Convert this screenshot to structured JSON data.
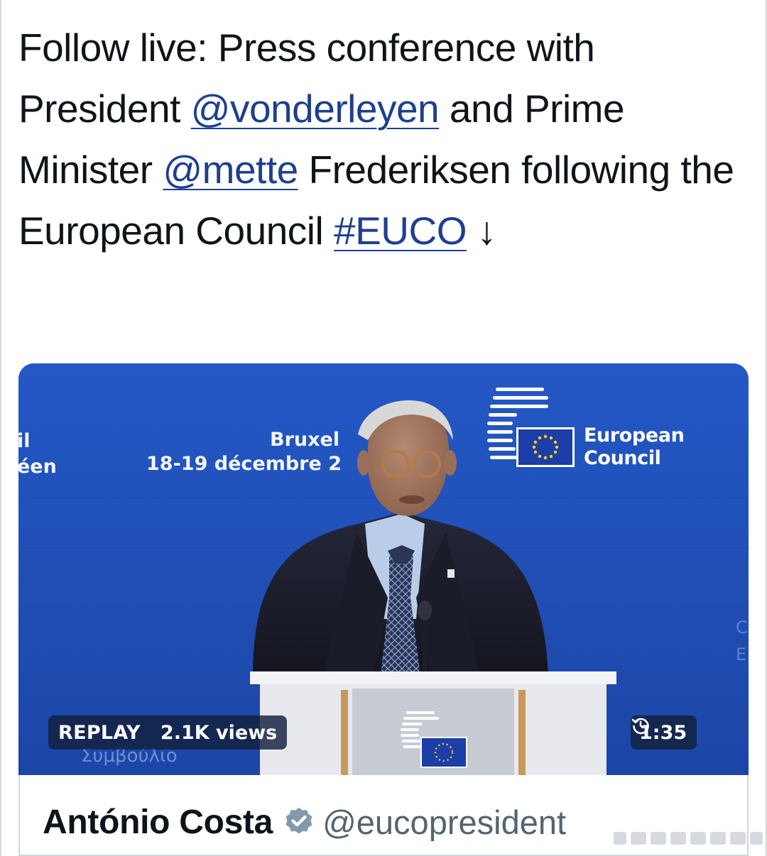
{
  "tweet": {
    "text_part1": "Follow live: Press conference with President ",
    "mention1": "@vonderleyen",
    "text_part2": " and Prime Minister ",
    "mention2": "@mette",
    "text_part3": " Frederiksen following the European Council ",
    "hashtag": "#EUCO",
    "arrow": "↓"
  },
  "video": {
    "backdrop": {
      "left_line1": "il",
      "left_line2": "éen",
      "city": "Bruxel",
      "dates": "18-19 décembre 2",
      "logo_line1": "European",
      "logo_line2": "Council",
      "podium_text": "Συμβούλιο"
    },
    "replay_label": "REPLAY",
    "views": "2.1K views",
    "duration": "1:35",
    "history_icon": "history-clock-icon",
    "colors": {
      "backdrop": "#2150b8",
      "flag": "#1b3ea8",
      "stars": "#ffd21f"
    }
  },
  "quoted_card": {
    "author_name": "António Costa",
    "verified_icon": "verified-badge-icon",
    "handle": "@eucopresident"
  }
}
